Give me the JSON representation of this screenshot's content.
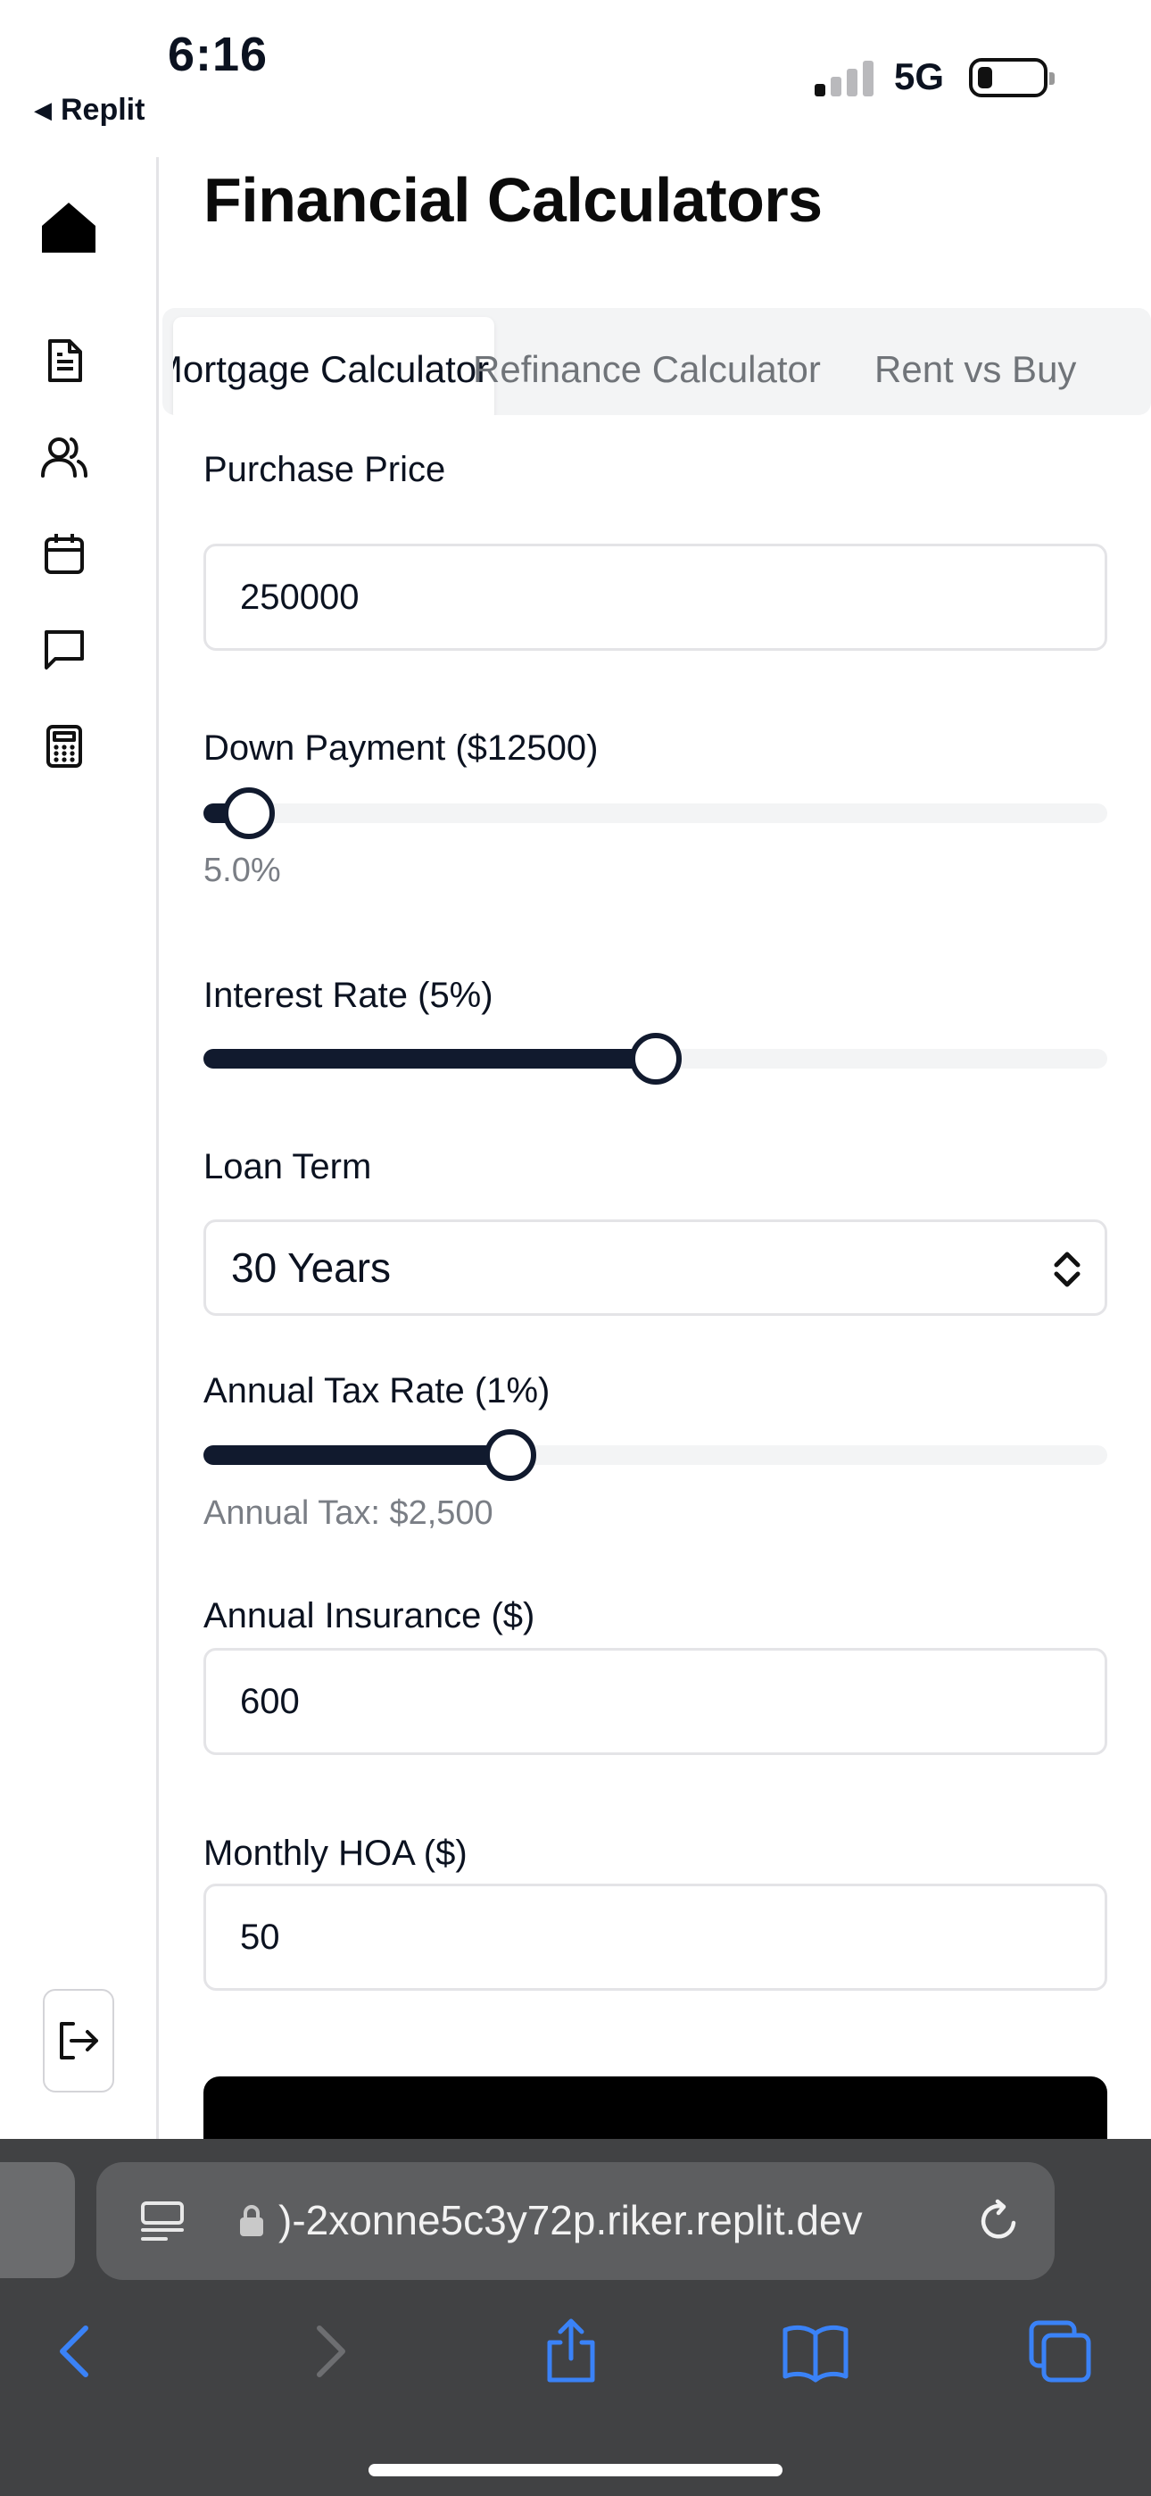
{
  "status_bar": {
    "time": "6:16",
    "back_app": "Replit",
    "network": "5G"
  },
  "page": {
    "title": "Financial Calculators"
  },
  "tabs": [
    {
      "label": "Mortgage Calculator",
      "active": true
    },
    {
      "label": "Refinance Calculator",
      "active": false
    },
    {
      "label": "Rent vs Buy",
      "active": false
    }
  ],
  "form": {
    "purchase_price": {
      "label": "Purchase Price",
      "value": "250000"
    },
    "down_payment": {
      "label": "Down Payment ($12500)",
      "percent_text": "5.0%",
      "slider_fraction": 0.05
    },
    "interest_rate": {
      "label": "Interest Rate (5%)",
      "slider_fraction": 0.5
    },
    "loan_term": {
      "label": "Loan Term",
      "value": "30 Years"
    },
    "annual_tax_rate": {
      "label": "Annual Tax Rate (1%)",
      "annual_tax_text": "Annual Tax: $2,500",
      "slider_fraction": 0.34
    },
    "annual_insurance": {
      "label": "Annual Insurance ($)",
      "value": "600"
    },
    "monthly_hoa": {
      "label": "Monthly HOA ($)",
      "value": "50"
    }
  },
  "browser": {
    "url": ")-2xonne5c3y72p.riker.replit.dev"
  },
  "sidebar_icons": [
    "home-icon",
    "document-icon",
    "users-icon",
    "calendar-icon",
    "message-icon",
    "calculator-icon"
  ],
  "colors": {
    "accent": "#111a2e",
    "track": "#f3f4f5",
    "muted_text": "#7a7e85",
    "browser_chrome": "#414244",
    "ios_blue": "#3a82f7"
  }
}
